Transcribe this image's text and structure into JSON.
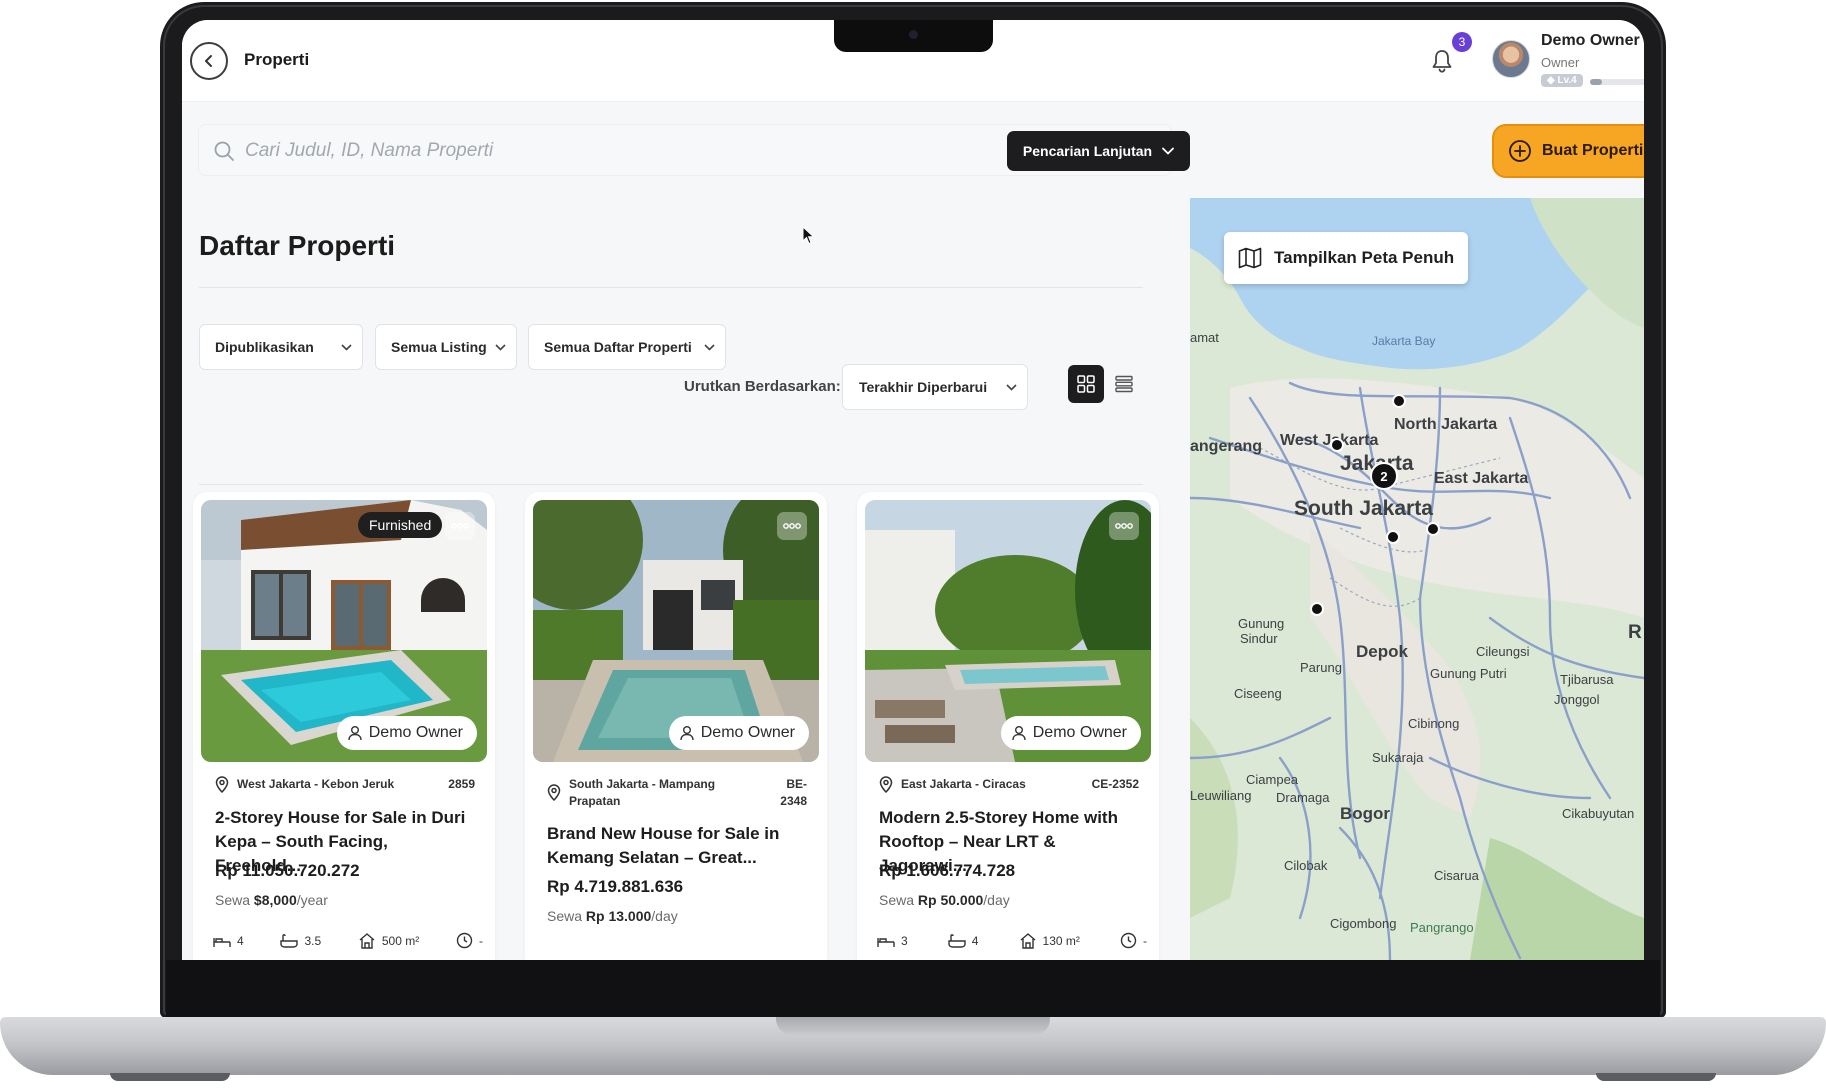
{
  "header": {
    "page_label": "Properti",
    "notification_count": "3",
    "user_name": "Demo Owner",
    "user_role": "Owner",
    "user_level": "Lv.4"
  },
  "search": {
    "placeholder": "Cari Judul, ID, Nama Properti",
    "advanced_label": "Pencarian Lanjutan"
  },
  "create_button_label": "Buat Properti",
  "list": {
    "title": "Daftar Properti",
    "filters": [
      "Dipublikasikan",
      "Semua Listing",
      "Semua Daftar Properti"
    ],
    "sort_label": "Urutkan Berdasarkan:",
    "sort_value": "Terakhir Diperbarui"
  },
  "properties": [
    {
      "badge": "Furnished",
      "owner": "Demo Owner",
      "location": "West Jakarta - Kebon Jeruk",
      "id": "2859",
      "title": "2-Storey House for Sale in Duri Kepa – South Facing, Freehold...",
      "price": "Rp 11.050.720.272",
      "rent_prefix": "Sewa",
      "rent_value": "$8,000",
      "rent_unit": "/year",
      "beds": "4",
      "baths": "3.5",
      "area": "500 m²",
      "time": "-"
    },
    {
      "badge": "",
      "owner": "Demo Owner",
      "location": "South Jakarta - Mampang Prapatan",
      "id": "BE-2348",
      "title": "Brand New House for Sale in Kemang Selatan – Great...",
      "price": "Rp 4.719.881.636",
      "rent_prefix": "Sewa",
      "rent_value": "Rp 13.000",
      "rent_unit": "/day",
      "beds": "",
      "baths": "",
      "area": "",
      "time": ""
    },
    {
      "badge": "",
      "owner": "Demo Owner",
      "location": "East Jakarta - Ciracas",
      "id": "CE-2352",
      "title": "Modern 2.5-Storey Home with Rooftop – Near LRT & Jagorawi...",
      "price": "Rp 1.606.774.728",
      "rent_prefix": "Sewa",
      "rent_value": "Rp 50.000",
      "rent_unit": "/day",
      "beds": "3",
      "baths": "4",
      "area": "130 m²",
      "time": "-"
    }
  ],
  "map": {
    "full_map_label": "Tampilkan Peta Penuh",
    "cluster_count": "2",
    "places": {
      "jakarta_bay": "Jakarta Bay",
      "north_jakarta": "North Jakarta",
      "west_jakarta": "West Jakarta",
      "jakarta": "Jakarta",
      "east_jakarta": "East Jakarta",
      "south_jakarta": "South Jakarta",
      "tangerang": "angerang",
      "amat": "amat",
      "gunung_sindur_1": "Gunung",
      "gunung_sindur_2": "Sindur",
      "parung": "Parung",
      "depok": "Depok",
      "cileungsi": "Cileungsi",
      "gunung_putri": "Gunung Putri",
      "tjibarusa": "Tjibarusa",
      "jonggol": "Jonggol",
      "ciseeng": "Ciseeng",
      "cibinong": "Cibinong",
      "sukaraja": "Sukaraja",
      "ciampea": "Ciampea",
      "leuwiliang": "Leuwiliang",
      "dramaga": "Dramaga",
      "bogor": "Bogor",
      "cikabuyutan": "Cikabuyutan",
      "cilobak": "Cilobak",
      "cisarua": "Cisarua",
      "cigombong": "Cigombong",
      "pangrango": "Pangrango",
      "edge_r": "R"
    }
  },
  "colors": {
    "accent_orange": "#f6a623",
    "dark": "#1d1d1f",
    "badge_purple": "#6a3fd6",
    "water": "#aed3f1",
    "road": "#8aa0c8"
  }
}
